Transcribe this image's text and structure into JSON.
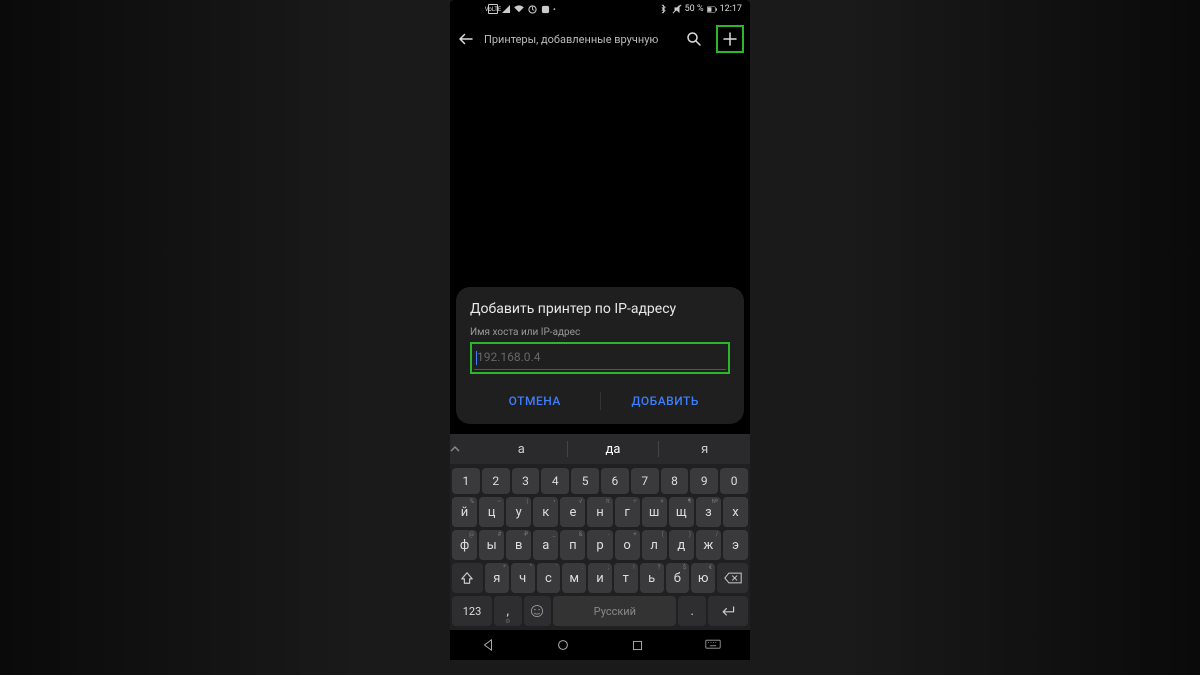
{
  "status": {
    "volte": "VoLTE",
    "battery": "50 %",
    "time": "12:17"
  },
  "header": {
    "title": "Принтеры, добавленные вручную"
  },
  "dialog": {
    "title": "Добавить принтер по IP-адресу",
    "label": "Имя хоста или IP-адрес",
    "placeholder": "192.168.0.4",
    "cancel": "ОТМЕНА",
    "add": "ДОБАВИТЬ"
  },
  "suggestions": {
    "s1": "а",
    "s2": "да",
    "s3": "я"
  },
  "keyboard": {
    "row_num": [
      "1",
      "2",
      "3",
      "4",
      "5",
      "6",
      "7",
      "8",
      "9",
      "0"
    ],
    "row1_sec": [
      "%",
      "~",
      "|",
      "•",
      "√",
      "π",
      "÷",
      "×",
      "¶",
      "№"
    ],
    "row1": [
      "й",
      "ц",
      "у",
      "к",
      "е",
      "н",
      "г",
      "ш",
      "щ",
      "з",
      "х"
    ],
    "row2_sec": [
      "@",
      "#",
      "₽",
      "_",
      "&",
      "-",
      "+",
      "(",
      ")",
      "/",
      ""
    ],
    "row2": [
      "ф",
      "ы",
      "в",
      "а",
      "п",
      "р",
      "о",
      "л",
      "д",
      "ж",
      "э"
    ],
    "row3_sec": [
      "*",
      "\"",
      "'",
      ":",
      ";",
      "!",
      "?",
      "$",
      "€"
    ],
    "row3": [
      "я",
      "ч",
      "с",
      "м",
      "и",
      "т",
      "ь",
      "б",
      "ю"
    ],
    "key_123": "123",
    "space": "Русский"
  }
}
